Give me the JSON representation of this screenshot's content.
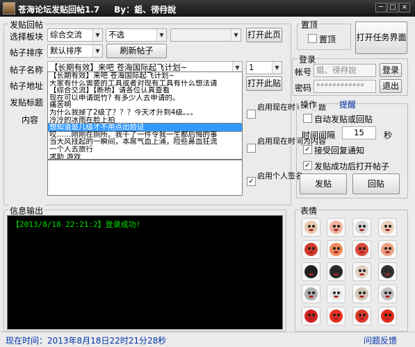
{
  "window": {
    "title": "苍海论坛发贴回帖1.7     By：鉏、徬冄說",
    "controls": [
      "─",
      "□",
      "×"
    ]
  },
  "post": {
    "group_label": "发贴回帖",
    "board_label": "选择板块",
    "board_value": "综合交流",
    "sub_board_value": "不选",
    "extra_select_value": "",
    "open_page_button": "打开此页",
    "sort_label": "帖子排序",
    "sort_value": "默认排序",
    "refresh_button": "刷新帖子",
    "name_label": "帖子名称",
    "name_value": "【长期有效】来吧 苍海国际起飞计划~",
    "page_value": "1",
    "address_label": "帖子地址",
    "open_post_button": "打开此贴",
    "post_title_label": "发贴标题",
    "content_label": "内容",
    "title_list": [
      "【长期有效】来吧 苍海国际起飞计划~",
      "大家有什么需要的工具或者对现有工具有什么想法请",
      "【综合交流】【断桥】请各位认真查看",
      "现在可以申请斑竹? 有多少人去申请的。",
      "痛苦啊",
      "为什么我掉了2级了？？？今天才升到4级。。。",
      "冷冷的冰雨在脸上拍",
      "想知道是几级才不用点出验证",
      "哎……刚刚在厕所。我干了一件令我一生都后悔的事",
      "当大风挂起的一瞬间，本屌气血上涌，险些鼻血狂流",
      "一个人去旅行",
      "求助 游戏"
    ],
    "selected_index": 7,
    "option_time_title": "启用现在时间为标题",
    "option_time_content": "启用现在时间为内容",
    "option_signature": "启用个人签名",
    "option_signature_checked": true
  },
  "top": {
    "group_label": "置顶",
    "pin_label": "置顶",
    "pin_checked": false,
    "open_task_button": "打开任务界面"
  },
  "login": {
    "group_label": "登录",
    "account_label": "帐号",
    "account_value": "鉏、徬冄說",
    "password_label": "密码",
    "password_value": "************",
    "login_button": "登录",
    "logout_button": "退出"
  },
  "ops": {
    "group_label": "操作",
    "remind_label": "提醒",
    "auto_label": "自动发贴或回贴",
    "auto_checked": false,
    "interval_label": "时间间隔",
    "interval_value": "15",
    "interval_unit": "秒",
    "reply_notify_label": "接受回复通知",
    "reply_notify_checked": true,
    "open_after_label": "发贴成功后打开帖子",
    "open_after_checked": true,
    "post_button": "发贴",
    "reply_button": "回贴"
  },
  "log": {
    "group_label": "信息输出",
    "lines": [
      "【2013/8/18 22:21:2】登录成功!"
    ]
  },
  "emotes": {
    "group_label": "表情",
    "icons": [
      "face-icon",
      "face-icon",
      "face-icon",
      "face-icon",
      "face-icon",
      "face-icon",
      "face-icon",
      "face-icon",
      "face-icon",
      "face-icon",
      "face-icon",
      "face-icon",
      "face-icon",
      "face-icon",
      "face-icon",
      "face-icon",
      "face-icon",
      "face-icon",
      "face-icon",
      "face-icon"
    ],
    "colors": [
      "#e8c9b0",
      "#f0b0a0",
      "#d8d8d8",
      "#e8d0b8",
      "#d03a2a",
      "#f08a5a",
      "#d84a3a",
      "#e8a080",
      "#202020",
      "#2a2a2a",
      "#e0d0c0",
      "#303030",
      "#b0b0b0",
      "#e8e8e8",
      "#d0c8b8",
      "#c0c0c0",
      "#d02020",
      "#e83020",
      "#d83a2a",
      "#e02818"
    ]
  },
  "status": {
    "time_text": "现在时间：2013年8月18日22时21分28秒",
    "feedback_link": "问题反馈"
  }
}
